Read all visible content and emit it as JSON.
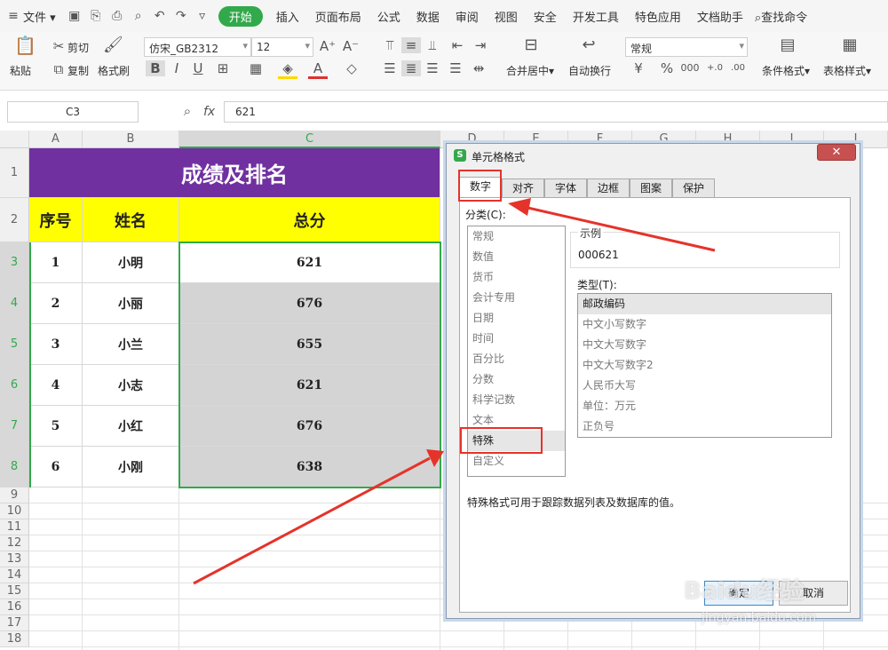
{
  "menu": {
    "file": "文件",
    "tabs": [
      "开始",
      "插入",
      "页面布局",
      "公式",
      "数据",
      "审阅",
      "视图",
      "安全",
      "开发工具",
      "特色应用",
      "文档助手"
    ],
    "search": "查找命令"
  },
  "ribbon": {
    "paste": "粘贴",
    "cut": "剪切",
    "copy": "复制",
    "format_painter": "格式刷",
    "font_name": "仿宋_GB2312",
    "font_size": "12",
    "merge": "合并居中",
    "wrap": "自动换行",
    "number_format": "常规",
    "cond_format": "条件格式",
    "table_style": "表格样式"
  },
  "formula": {
    "cell_ref": "C3",
    "fx": "fx",
    "value": "621"
  },
  "sheet": {
    "columns": [
      "A",
      "B",
      "C",
      "D",
      "E",
      "F",
      "G",
      "H",
      "I",
      "J"
    ],
    "rows": [
      "1",
      "2",
      "3",
      "4",
      "5",
      "6",
      "7",
      "8",
      "9",
      "10",
      "11",
      "12",
      "13",
      "14",
      "15",
      "16",
      "17",
      "18"
    ],
    "title": "成绩及排名",
    "headers": [
      "序号",
      "姓名",
      "总分"
    ],
    "data": [
      [
        "1",
        "小明",
        "621"
      ],
      [
        "2",
        "小丽",
        "676"
      ],
      [
        "3",
        "小兰",
        "655"
      ],
      [
        "4",
        "小志",
        "621"
      ],
      [
        "5",
        "小红",
        "676"
      ],
      [
        "6",
        "小刚",
        "638"
      ]
    ],
    "colors": {
      "title_bg": "#7030a0",
      "header_bg": "#ffff00",
      "selection": "#d4d4d4",
      "accent": "#32a94b"
    }
  },
  "dialog": {
    "title": "单元格格式",
    "tabs": [
      "数字",
      "对齐",
      "字体",
      "边框",
      "图案",
      "保护"
    ],
    "category_label": "分类(C):",
    "categories": [
      "常规",
      "数值",
      "货币",
      "会计专用",
      "日期",
      "时间",
      "百分比",
      "分数",
      "科学记数",
      "文本",
      "特殊",
      "自定义"
    ],
    "sample_label": "示例",
    "sample_value": "000621",
    "type_label": "类型(T):",
    "types": [
      "邮政编码",
      "中文小写数字",
      "中文大写数字",
      "中文大写数字2",
      "人民币大写",
      "单位：万元",
      "正负号"
    ],
    "description": "特殊格式可用于跟踪数据列表及数据库的值。",
    "ok": "确定",
    "cancel": "取消"
  },
  "watermark": {
    "brand": "Baidu经验",
    "url": "jingyan.baidu.com"
  }
}
